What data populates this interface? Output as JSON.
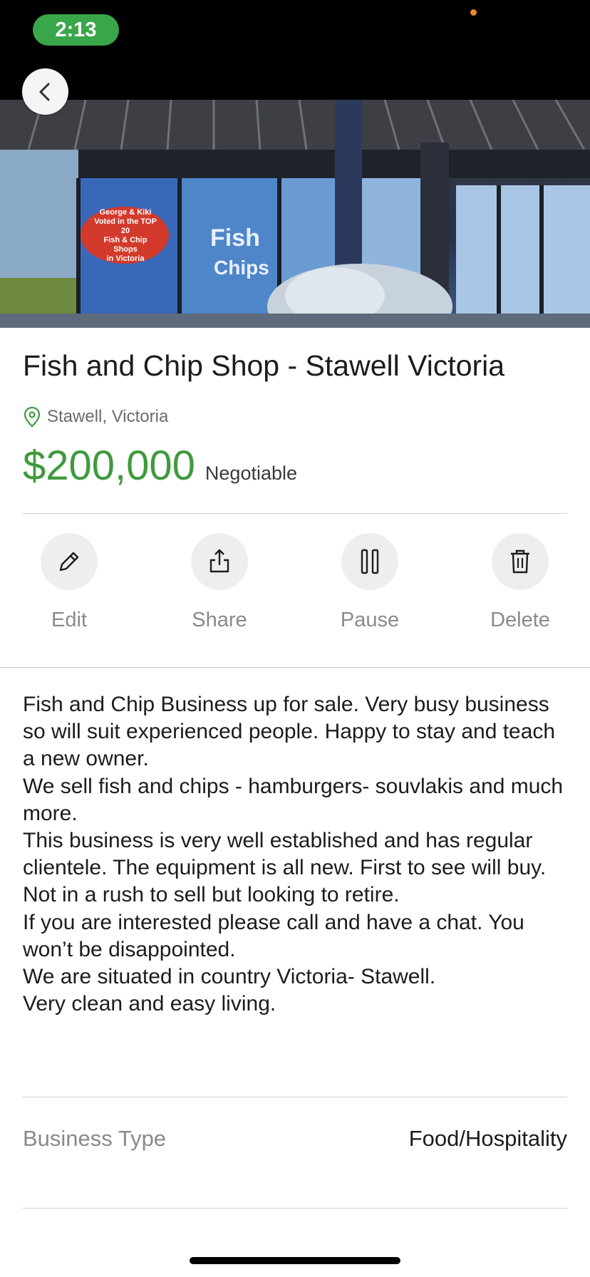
{
  "status_bar": {
    "time": "2:13"
  },
  "listing": {
    "title": "Fish and Chip Shop - Stawell Victoria",
    "location": "Stawell, Victoria",
    "price": "$200,000",
    "price_note": "Negotiable"
  },
  "hero_image": {
    "sign_text_1": "George & Kiki",
    "sign_text_2": "Voted in the TOP 20",
    "sign_text_3": "Fish & Chip Shops",
    "sign_text_4": "in Victoria",
    "neon_1": "Fish",
    "neon_2": "Chips"
  },
  "actions": [
    {
      "label": "Edit",
      "icon": "pencil-icon"
    },
    {
      "label": "Share",
      "icon": "share-icon"
    },
    {
      "label": "Pause",
      "icon": "pause-icon"
    },
    {
      "label": "Delete",
      "icon": "trash-icon"
    }
  ],
  "description": [
    "Fish and Chip Business up for sale. Very busy business so will suit experienced people. Happy to stay and teach a new owner.",
    "We sell fish and chips - hamburgers- souvlakis and much more.",
    "This business is very well established and has regular clientele. The equipment is all new. First to see will buy.",
    "Not in a rush to sell but looking to retire.",
    "If you are interested please call and have a chat. You won’t be disappointed.",
    "We are situated in country Victoria- Stawell.",
    "Very clean and easy living."
  ],
  "details": {
    "business_type_label": "Business Type",
    "business_type_value": "Food/Hospitality"
  },
  "colors": {
    "accent_green": "#3f9a3d",
    "time_pill": "#3aa64a",
    "icon_gray": "#8a8a8e"
  }
}
